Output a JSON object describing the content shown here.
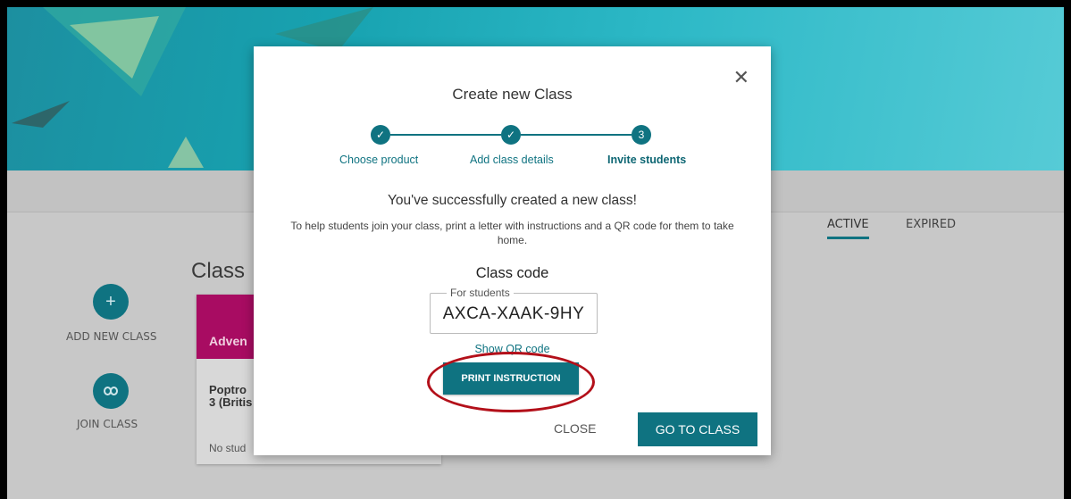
{
  "background": {
    "classes_title": "Class",
    "sidebar": {
      "add_label": "ADD NEW CLASS",
      "join_label": "JOIN CLASS"
    },
    "card": {
      "header": "Adven",
      "title_line1": "Poptro",
      "title_line2": "3 (Britis",
      "footer": "No stud"
    },
    "tabs": [
      {
        "label": "ACTIVE",
        "active": true
      },
      {
        "label": "EXPIRED",
        "active": false
      }
    ]
  },
  "modal": {
    "title": "Create new Class",
    "steps": [
      {
        "label": "Choose product",
        "state": "done",
        "marker": "✓"
      },
      {
        "label": "Add class details",
        "state": "done",
        "marker": "✓"
      },
      {
        "label": "Invite students",
        "state": "current",
        "marker": "3"
      }
    ],
    "success_message": "You've successfully created a new class!",
    "help_text": "To help students join your class, print a letter with instructions and a QR code for them to take home.",
    "code_heading": "Class code",
    "code_legend": "For students",
    "code_value": "AXCA-XAAK-9HY",
    "qr_link": "Show QR code",
    "print_button": "PRINT INSTRUCTION",
    "close_button": "CLOSE",
    "goto_button": "GO TO CLASS"
  },
  "colors": {
    "accent": "#0f7381",
    "card_header": "#a80c62",
    "highlight": "#b3101a"
  }
}
